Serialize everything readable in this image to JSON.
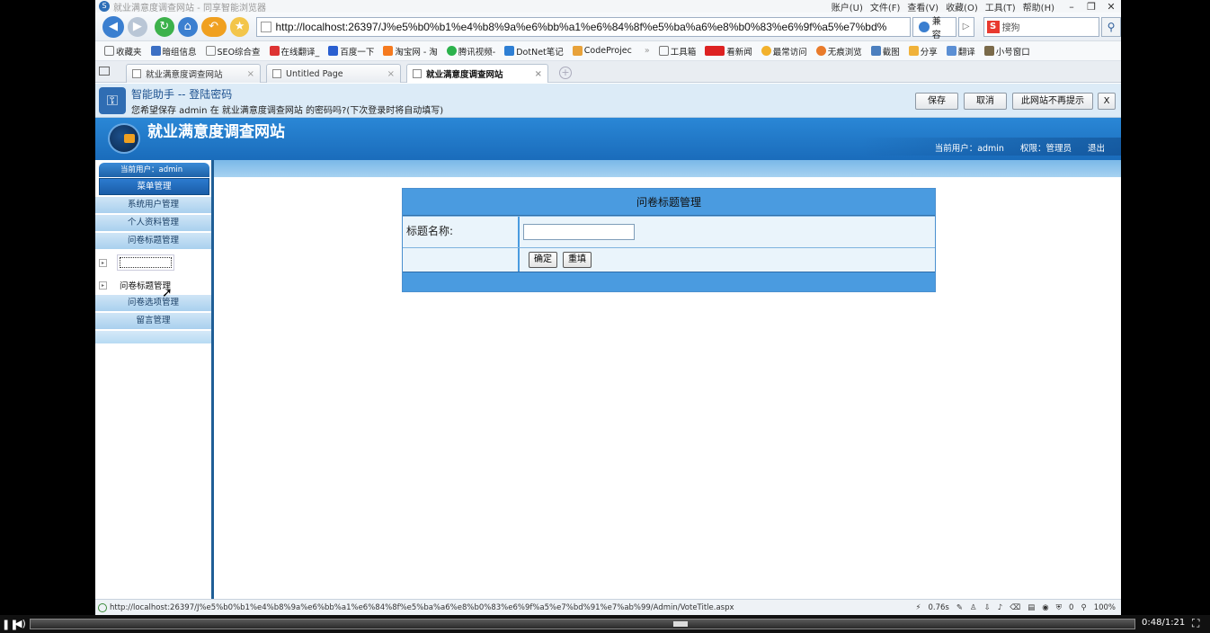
{
  "browser": {
    "title": "就业满意度调查网站 - 同享智能浏览器",
    "menus": [
      "账户(U)",
      "文件(F)",
      "查看(V)",
      "收藏(O)",
      "工具(T)",
      "帮助(H)"
    ],
    "url": "http://localhost:26397/J%e5%b0%b1%e4%b8%9a%e6%bb%a1%e6%84%8f%e5%ba%a6%e8%b0%83%e6%9f%a5%e7%bd%",
    "compat_label": "兼容",
    "search_placeholder": "搜狗",
    "favorites": [
      "收藏夹",
      "暗组信息",
      "SEO综合查",
      "在线翻译_",
      "百度一下",
      "淘宝网 - 淘",
      "腾讯视频-",
      "DotNet笔记",
      "CodeProjec"
    ],
    "right_tools": [
      "工具箱",
      "看新闻",
      "最常访问",
      "无痕浏览",
      "截图",
      "分享",
      "翻译",
      "小号窗口"
    ],
    "tabs": [
      {
        "label": "就业满意度调查网站",
        "active": false
      },
      {
        "label": "Untitled Page",
        "active": false
      },
      {
        "label": "就业满意度调查网站",
        "active": true
      }
    ],
    "status_url": "http://localhost:26397/J%e5%b0%b1%e4%b8%9a%e6%bb%a1%e6%84%8f%e5%ba%a6%e8%b0%83%e6%9f%a5%e7%bd%91%e7%ab%99/Admin/VoteTitle.aspx",
    "status_time": "0.76s",
    "status_count": "0",
    "zoom": "100%"
  },
  "password_bar": {
    "title": "智能助手 -- 登陆密码",
    "message": "您希望保存 admin 在 就业满意度调查网站 的密码吗?(下次登录时将自动填写)",
    "save": "保存",
    "cancel": "取消",
    "never": "此网站不再提示",
    "close": "X"
  },
  "site": {
    "title": "就业满意度调查网站",
    "current_user": "当前用户：admin",
    "role": "权限：管理员",
    "logout": "退出"
  },
  "sidebar": {
    "head": "当前用户：admin",
    "menu_title": "菜单管理",
    "items": [
      "系统用户管理",
      "个人资料管理",
      "问卷标题管理"
    ],
    "tree_item": "问卷标题管理",
    "items_after": [
      "问卷选项管理",
      "留言管理"
    ]
  },
  "form": {
    "title": "问卷标题管理",
    "label_title": "标题名称:",
    "input_value": "",
    "confirm": "确定",
    "reset": "重填"
  },
  "player": {
    "time": "0:48/1:21",
    "progress": 0.59
  }
}
